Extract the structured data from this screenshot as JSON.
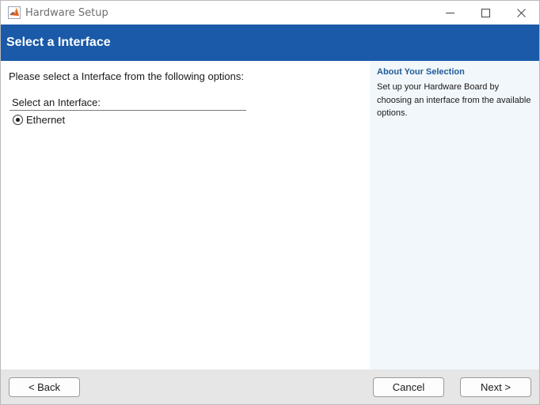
{
  "window": {
    "title": "Hardware Setup",
    "app_icon": "matlab-icon",
    "controls": [
      "minimize-icon",
      "maximize-icon",
      "close-icon"
    ]
  },
  "header": {
    "title": "Select a Interface",
    "background_color": "#1a5aa8"
  },
  "main": {
    "instruction": "Please select a Interface from the following options:",
    "group_label": "Select an Interface:",
    "options": [
      {
        "label": "Ethernet",
        "selected": true
      }
    ]
  },
  "side_panel": {
    "title": "About Your Selection",
    "text": "Set up your Hardware Board by choosing an interface from the available options.",
    "title_color": "#1f5b9a",
    "background_color": "#f2f7fb"
  },
  "footer": {
    "back_label": "< Back",
    "cancel_label": "Cancel",
    "next_label": "Next >"
  }
}
